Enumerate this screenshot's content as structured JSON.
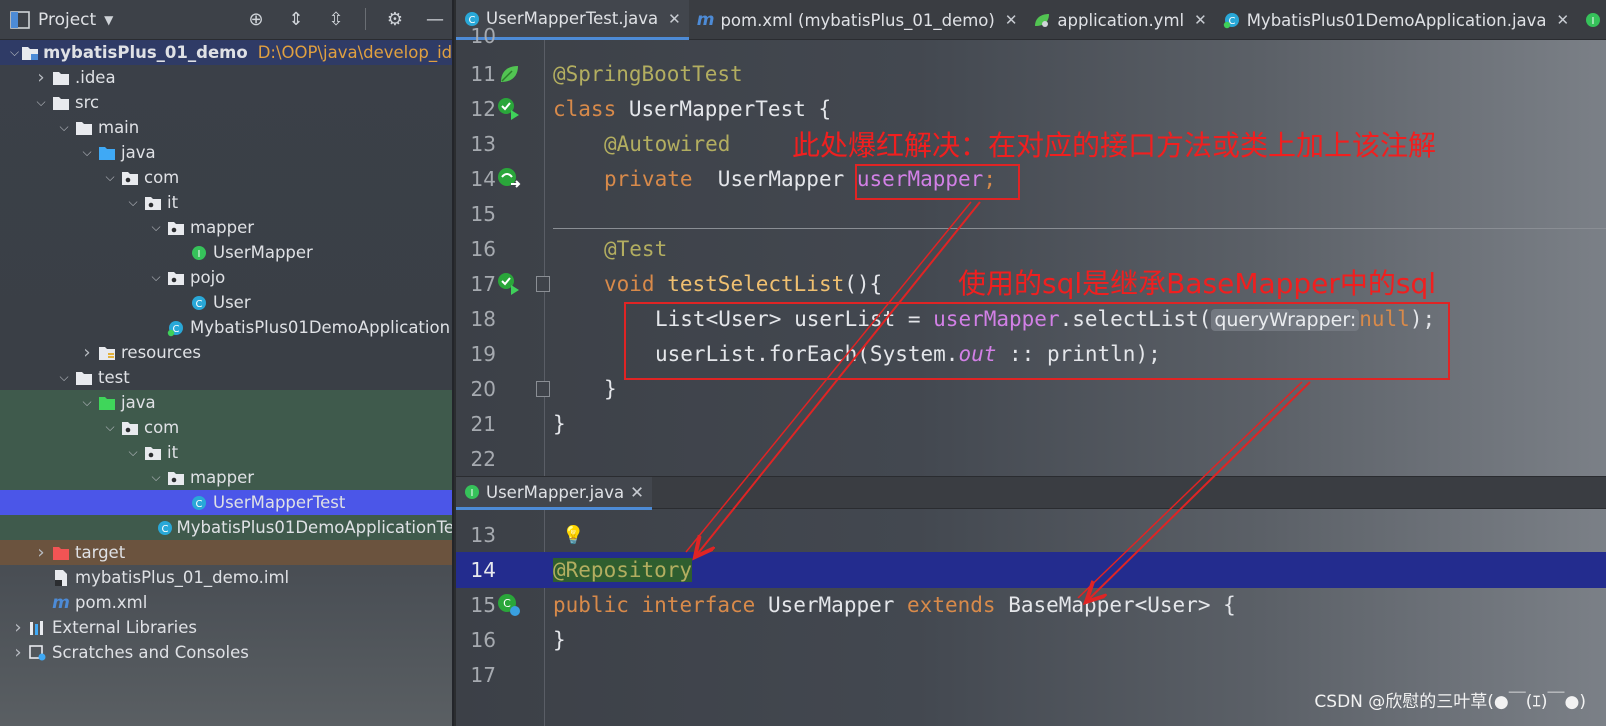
{
  "project_panel": {
    "title": "Project",
    "tree": [
      {
        "label": "mybatisPlus_01_demo",
        "path": "D:\\OOP\\java\\develop_idea\\",
        "indent": 0,
        "arrow": "down",
        "icon": "module-folder",
        "kind": "root"
      },
      {
        "label": ".idea",
        "indent": 1,
        "arrow": "right",
        "icon": "folder"
      },
      {
        "label": "src",
        "indent": 1,
        "arrow": "down",
        "icon": "folder"
      },
      {
        "label": "main",
        "indent": 2,
        "arrow": "down",
        "icon": "folder"
      },
      {
        "label": "java",
        "indent": 3,
        "arrow": "down",
        "icon": "source-folder"
      },
      {
        "label": "com",
        "indent": 4,
        "arrow": "down",
        "icon": "package"
      },
      {
        "label": "it",
        "indent": 5,
        "arrow": "down",
        "icon": "package"
      },
      {
        "label": "mapper",
        "indent": 6,
        "arrow": "down",
        "icon": "package"
      },
      {
        "label": "UserMapper",
        "indent": 7,
        "arrow": "",
        "icon": "interface"
      },
      {
        "label": "pojo",
        "indent": 6,
        "arrow": "down",
        "icon": "package"
      },
      {
        "label": "User",
        "indent": 7,
        "arrow": "",
        "icon": "class"
      },
      {
        "label": "MybatisPlus01DemoApplication",
        "indent": 6,
        "arrow": "",
        "icon": "spring-class"
      },
      {
        "label": "resources",
        "indent": 3,
        "arrow": "right",
        "icon": "resources-folder"
      },
      {
        "label": "test",
        "indent": 2,
        "arrow": "down",
        "icon": "folder"
      },
      {
        "label": "java",
        "indent": 3,
        "arrow": "down",
        "icon": "test-folder",
        "kind": "test"
      },
      {
        "label": "com",
        "indent": 4,
        "arrow": "down",
        "icon": "package",
        "kind": "test"
      },
      {
        "label": "it",
        "indent": 5,
        "arrow": "down",
        "icon": "package",
        "kind": "test"
      },
      {
        "label": "mapper",
        "indent": 6,
        "arrow": "down",
        "icon": "package",
        "kind": "test"
      },
      {
        "label": "UserMapperTest",
        "indent": 7,
        "arrow": "",
        "icon": "class",
        "kind": "sel"
      },
      {
        "label": "MybatisPlus01DemoApplicationTe",
        "indent": 6,
        "arrow": "",
        "icon": "class",
        "kind": "test"
      },
      {
        "label": "target",
        "indent": 1,
        "arrow": "right",
        "icon": "excluded-folder",
        "kind": "target"
      },
      {
        "label": "mybatisPlus_01_demo.iml",
        "indent": 1,
        "arrow": "",
        "icon": "iml-file"
      },
      {
        "label": "pom.xml",
        "indent": 1,
        "arrow": "",
        "icon": "maven-file"
      },
      {
        "label": "External Libraries",
        "indent": 0,
        "arrow": "right",
        "icon": "libraries"
      },
      {
        "label": "Scratches and Consoles",
        "indent": 0,
        "arrow": "right",
        "icon": "scratches"
      }
    ]
  },
  "tabs": [
    {
      "label": "UserMapperTest.java",
      "icon": "class",
      "active": true,
      "closable": true
    },
    {
      "label": "pom.xml (mybatisPlus_01_demo)",
      "icon": "maven",
      "active": false,
      "closable": true
    },
    {
      "label": "application.yml",
      "icon": "yml",
      "active": false,
      "closable": true
    },
    {
      "label": "MybatisPlus01DemoApplication.java",
      "icon": "spring-class",
      "active": false,
      "closable": true
    },
    {
      "label": "UserMapper",
      "icon": "interface",
      "active": false,
      "closable": false
    }
  ],
  "top_editor": {
    "partial_line_number": "10",
    "line_numbers": [
      "11",
      "12",
      "13",
      "14",
      "15",
      "16",
      "17",
      "18",
      "19",
      "20",
      "21",
      "22"
    ]
  },
  "bottom_tab": {
    "label": "UserMapper.java"
  },
  "bottom_editor": {
    "line_numbers": [
      "13",
      "14",
      "15",
      "16",
      "17"
    ]
  },
  "code": {
    "l11": {
      "ann": "@SpringBootTest"
    },
    "l12": {
      "kw": "class",
      "name": " UserMapperTest {"
    },
    "l13": {
      "ann": "@Autowired"
    },
    "l14": {
      "kw": "private",
      "type": "  UserMapper ",
      "field": "userMapper",
      "end": ";"
    },
    "l16": {
      "ann": "@Test"
    },
    "l17": {
      "kw": "void",
      "fn": "testSelectList",
      "end": "(){"
    },
    "l18": {
      "a": "List<User> userList = ",
      "field": "userMapper",
      "b": ".selectList(",
      "hint": "queryWrapper:",
      "kw": "null",
      "end": ");"
    },
    "l19": {
      "a": "userList.forEach(System.",
      "it": "out",
      "b": " :: println);"
    },
    "l20": {
      "a": "}"
    },
    "l21": {
      "a": "}"
    },
    "b14": {
      "ann": "@Repository"
    },
    "b15": {
      "kw1": "public",
      "kw2": "interface",
      "name": " UserMapper ",
      "kw3": "extends",
      "rest": " BaseMapper<User> {"
    },
    "b16": {
      "a": "}"
    }
  },
  "annotations": {
    "note1": "此处爆红解决：在对应的接口方法或类上加上该注解",
    "note2": "使用的sql是继承BaseMapper中的sql",
    "color": "#f01f1f"
  },
  "watermark": "CSDN @欣慰的三叶草(●￣(ｴ)￣●)"
}
